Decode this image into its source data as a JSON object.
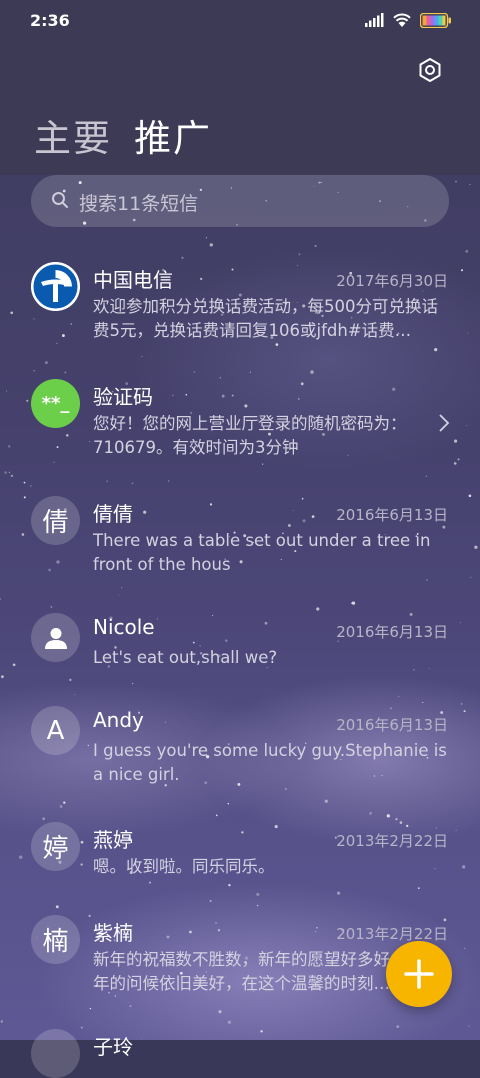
{
  "status_bar": {
    "time": "2:36",
    "icons": [
      "signal-icon",
      "wifi-icon",
      "battery-icon"
    ]
  },
  "header": {
    "settings_icon": "gear-icon",
    "tabs": [
      {
        "label": "主要",
        "active": false
      },
      {
        "label": "推广",
        "active": true
      }
    ]
  },
  "search": {
    "icon": "search-icon",
    "placeholder": "搜索11条短信"
  },
  "conversations": [
    {
      "name": "中国电信",
      "date": "2017年6月30日",
      "preview": "欢迎参加积分兑换话费活动，每500分可兑换话费5元，兑换话费请回复106或jfdh#话费…",
      "avatar_text": "",
      "avatar_icon": "china-telecom-logo-icon",
      "avatar_color": "#ffffff"
    },
    {
      "name": "验证码",
      "date": "",
      "preview": "您好！您的网上营业厅登录的随机密码为：710679。有效时间为3分钟",
      "avatar_text": "**_",
      "avatar_icon": "",
      "avatar_color": "#6ccf4a"
    },
    {
      "name": "倩倩",
      "date": "2016年6月13日",
      "preview": "There was a table set out under a tree in front of the hous",
      "avatar_text": "倩",
      "avatar_icon": "",
      "avatar_color": ""
    },
    {
      "name": "Nicole",
      "date": "2016年6月13日",
      "preview": "Let's eat out,shall we?",
      "avatar_text": "",
      "avatar_icon": "person-icon",
      "avatar_color": ""
    },
    {
      "name": "Andy",
      "date": "2016年6月13日",
      "preview": "I guess you're some lucky guy.Stephanie is a nice girl.",
      "avatar_text": "A",
      "avatar_icon": "",
      "avatar_color": ""
    },
    {
      "name": "燕婷",
      "date": "2013年2月22日",
      "preview": "嗯。收到啦。同乐同乐。",
      "avatar_text": "婷",
      "avatar_icon": "",
      "avatar_color": ""
    },
    {
      "name": "紫楠",
      "date": "2013年2月22日",
      "preview": "新年的祝福数不胜数，新年的愿望好多好多，新年的问候依旧美好，在这个温馨的时刻…",
      "avatar_text": "楠",
      "avatar_icon": "",
      "avatar_color": ""
    },
    {
      "name": "子玲",
      "date": "",
      "preview": "",
      "avatar_text": "",
      "avatar_icon": "",
      "avatar_color": ""
    }
  ],
  "fab": {
    "icon": "plus-icon",
    "color": "#f7b500"
  }
}
